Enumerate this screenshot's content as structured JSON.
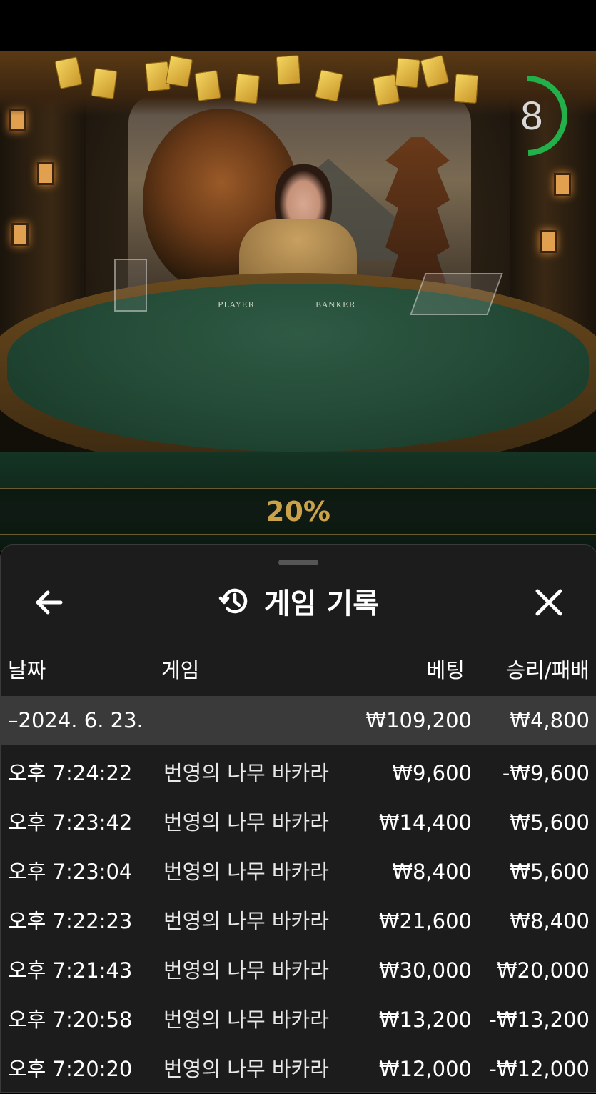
{
  "video": {
    "timer_value": "8",
    "table_labels": {
      "player": "PLAYER",
      "banker": "BANKER"
    },
    "multiplier_banner": "20%"
  },
  "history": {
    "title": "게임 기록",
    "columns": {
      "date": "날짜",
      "game": "게임",
      "bet": "베팅",
      "win_loss": "승리/패배"
    },
    "summary": {
      "date": "–2024. 6. 23.",
      "bet": "₩109,200",
      "win_loss": "₩4,800"
    },
    "rows": [
      {
        "time": "오후 7:24:22",
        "game": "번영의 나무 바카라",
        "bet": "₩9,600",
        "win_loss": "-₩9,600"
      },
      {
        "time": "오후 7:23:42",
        "game": "번영의 나무 바카라",
        "bet": "₩14,400",
        "win_loss": "₩5,600"
      },
      {
        "time": "오후 7:23:04",
        "game": "번영의 나무 바카라",
        "bet": "₩8,400",
        "win_loss": "₩5,600"
      },
      {
        "time": "오후 7:22:23",
        "game": "번영의 나무 바카라",
        "bet": "₩21,600",
        "win_loss": "₩8,400"
      },
      {
        "time": "오후 7:21:43",
        "game": "번영의 나무 바카라",
        "bet": "₩30,000",
        "win_loss": "₩20,000"
      },
      {
        "time": "오후 7:20:58",
        "game": "번영의 나무 바카라",
        "bet": "₩13,200",
        "win_loss": "-₩13,200"
      },
      {
        "time": "오후 7:20:20",
        "game": "번영의 나무 바카라",
        "bet": "₩12,000",
        "win_loss": "-₩12,000"
      }
    ]
  },
  "colors": {
    "timer_ring": "#22b04a",
    "banner_gold": "#c9a24a",
    "sheet_bg": "#1c1c1c",
    "summary_bg": "#3a3a3a"
  },
  "icons": {
    "back": "arrow-left-icon",
    "history": "history-clock-icon",
    "close": "close-icon"
  }
}
